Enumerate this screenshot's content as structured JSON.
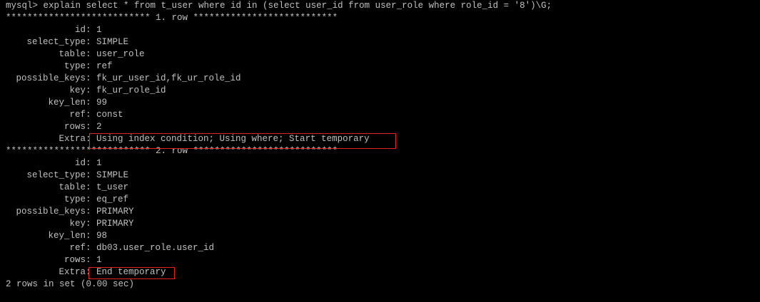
{
  "terminal": {
    "command_line": "mysql> explain select * from t_user where id in (select user_id from user_role where role_id = '8')\\G;",
    "row1_header": "*************************** 1. row ***************************",
    "row1": [
      {
        "key": "id",
        "value": "1"
      },
      {
        "key": "select_type",
        "value": "SIMPLE"
      },
      {
        "key": "table",
        "value": "user_role"
      },
      {
        "key": "type",
        "value": "ref"
      },
      {
        "key": "possible_keys",
        "value": "fk_ur_user_id,fk_ur_role_id"
      },
      {
        "key": "key",
        "value": "fk_ur_role_id"
      },
      {
        "key": "key_len",
        "value": "99"
      },
      {
        "key": "ref",
        "value": "const"
      },
      {
        "key": "rows",
        "value": "2"
      },
      {
        "key": "Extra",
        "value": "Using index condition; Using where; Start temporary"
      }
    ],
    "row2_header": "*************************** 2. row ***************************",
    "row2": [
      {
        "key": "id",
        "value": "1"
      },
      {
        "key": "select_type",
        "value": "SIMPLE"
      },
      {
        "key": "table",
        "value": "t_user"
      },
      {
        "key": "type",
        "value": "eq_ref"
      },
      {
        "key": "possible_keys",
        "value": "PRIMARY"
      },
      {
        "key": "key",
        "value": "PRIMARY"
      },
      {
        "key": "key_len",
        "value": "98"
      },
      {
        "key": "ref",
        "value": "db03.user_role.user_id"
      },
      {
        "key": "rows",
        "value": "1"
      },
      {
        "key": "Extra",
        "value": "End temporary"
      }
    ],
    "footer": "2 rows in set (0.00 sec)"
  },
  "colors": {
    "background": "#000000",
    "text": "#c0c0c0",
    "highlight_border": "#e0211d"
  }
}
